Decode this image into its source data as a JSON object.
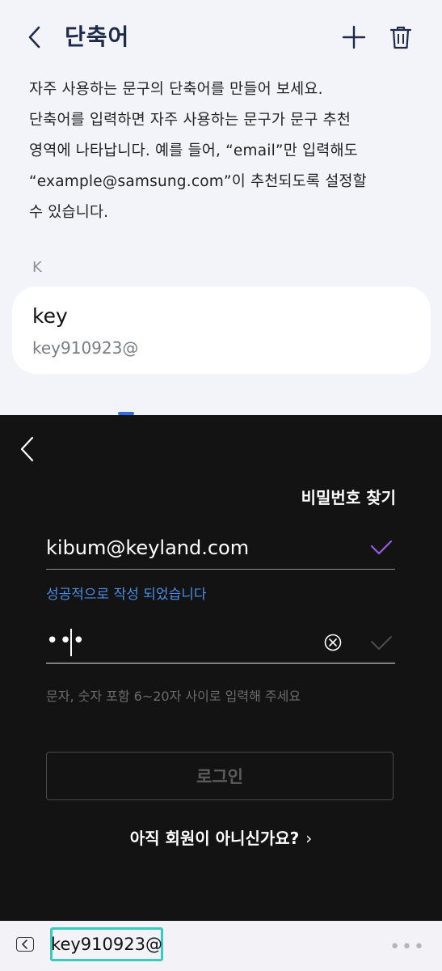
{
  "header": {
    "title": "단축어",
    "back_icon": "chevron-left-icon",
    "add_icon": "plus-icon",
    "delete_icon": "trash-icon"
  },
  "description": "자주 사용하는 문구의 단축어를 만들어 보세요.\n단축어를 입력하면 자주 사용하는 문구가 문구 추천\n영역에 나타납니다. 예를 들어, “email”만 입력해도\n“example@samsung.com”이 추천되도록 설정할\n수 있습니다.",
  "shortcuts": {
    "section_letter": "K",
    "items": [
      {
        "shortcut": "key",
        "phrase": "key910923@"
      }
    ]
  },
  "overlay": {
    "back_icon": "chevron-left-icon",
    "find_password": "비밀번호 찾기",
    "email_value": "kibum@keyland.com",
    "email_valid_color": "#9b5de5",
    "success_message": "성공적으로 작성 되었습니다",
    "success_color": "#4a8de6",
    "password_masked": "•••",
    "clear_icon": "clear-circle-icon",
    "password_hint": "문자, 숫자 포함 6~20자 사이로 입력해 주세요",
    "login_label": "로그인",
    "signup_prompt": "아직 회원이 아니신가요?",
    "signup_chevron": "›"
  },
  "keyboard": {
    "back_icon": "keyboard-back-icon",
    "suggestion": "key910923@",
    "more_label": "•••"
  }
}
